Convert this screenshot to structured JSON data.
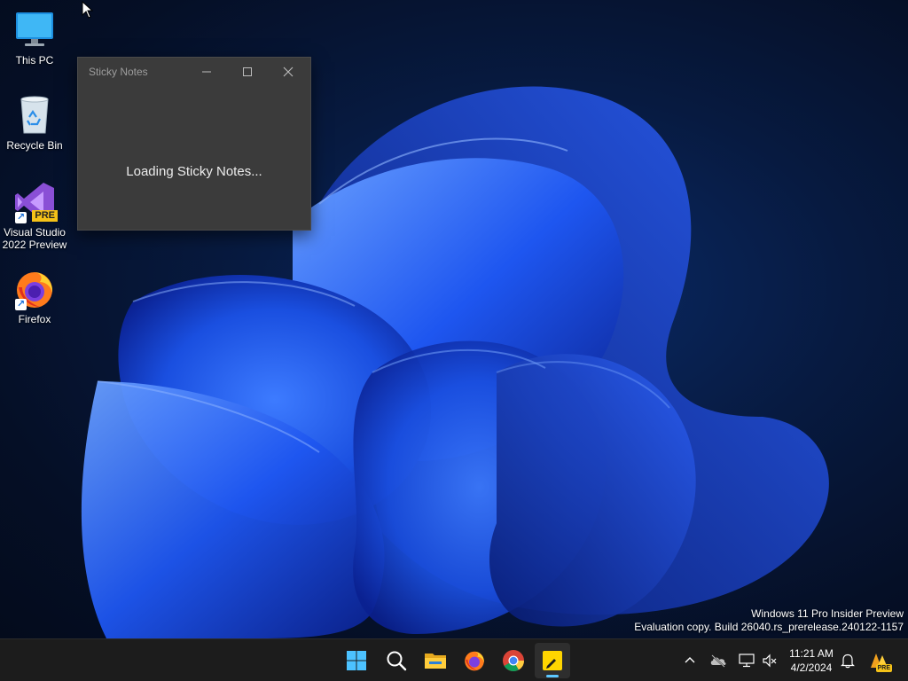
{
  "desktop_icons": [
    {
      "label": "This PC",
      "icon": "monitor-icon"
    },
    {
      "label": "Recycle Bin",
      "icon": "recycle-bin-icon"
    },
    {
      "label": "Visual Studio 2022 Preview",
      "line1": "Visual Studio",
      "line2": "2022 Preview",
      "icon": "visual-studio-icon",
      "badge": "PRE"
    },
    {
      "label": "Firefox",
      "icon": "firefox-icon"
    }
  ],
  "sticky_window": {
    "title": "Sticky Notes",
    "loading_text": "Loading Sticky Notes..."
  },
  "watermark": {
    "line1": "Windows 11 Pro Insider Preview",
    "line2": "Evaluation copy. Build 26040.rs_prerelease.240122-1157"
  },
  "taskbar": {
    "apps": [
      "start-icon",
      "search-icon",
      "file-explorer-icon",
      "firefox-icon",
      "chrome-icon",
      "sticky-notes-icon"
    ],
    "active_app": "sticky-notes-icon",
    "tray_icons": [
      "chevron-up-icon",
      "onedrive-icon",
      "network-icon",
      "volume-muted-icon",
      "notification-icon",
      "dev-home-icon"
    ],
    "dev_badge": "PRE",
    "time": "11:21 AM",
    "date": "4/2/2024"
  },
  "colors": {
    "accent": "#5cc8ff",
    "taskbar_bg": "#1c1c1c",
    "window_bg": "#3b3b3b",
    "wallpaper_blue": "#1a4fe0"
  }
}
